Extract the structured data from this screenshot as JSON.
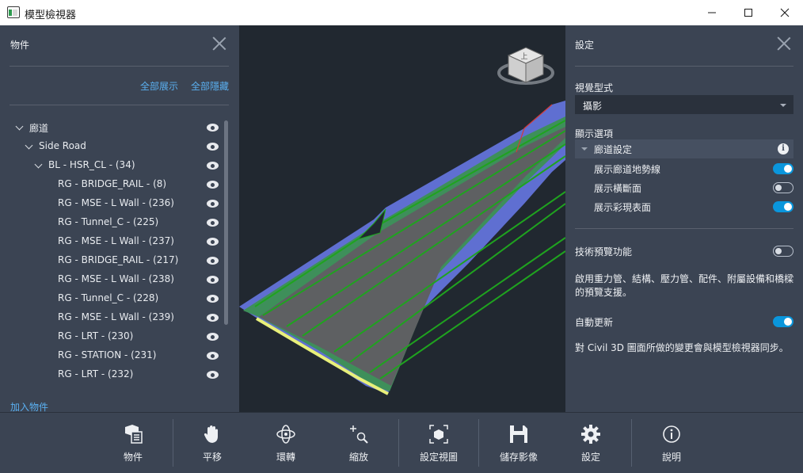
{
  "window": {
    "title": "模型檢視器",
    "minimize": "—",
    "maximize": "☐",
    "close": "✕"
  },
  "left_panel": {
    "title": "物件",
    "show_all": "全部展示",
    "hide_all": "全部隱藏",
    "add_object": "加入物件",
    "tree": [
      {
        "label": "廊道",
        "level": 0,
        "expandable": true,
        "visible": true
      },
      {
        "label": "Side Road",
        "level": 1,
        "expandable": true,
        "visible": true
      },
      {
        "label": "BL - HSR_CL - (34)",
        "level": 2,
        "expandable": true,
        "visible": true
      },
      {
        "label": "RG - BRIDGE_RAIL - (8)",
        "level": 3,
        "expandable": false,
        "visible": true
      },
      {
        "label": "RG - MSE - L Wall - (236)",
        "level": 3,
        "expandable": false,
        "visible": true
      },
      {
        "label": "RG - Tunnel_C - (225)",
        "level": 3,
        "expandable": false,
        "visible": true
      },
      {
        "label": "RG - MSE - L Wall - (237)",
        "level": 3,
        "expandable": false,
        "visible": true
      },
      {
        "label": "RG - BRIDGE_RAIL - (217)",
        "level": 3,
        "expandable": false,
        "visible": true
      },
      {
        "label": "RG - MSE - L Wall - (238)",
        "level": 3,
        "expandable": false,
        "visible": true
      },
      {
        "label": "RG - Tunnel_C - (228)",
        "level": 3,
        "expandable": false,
        "visible": true
      },
      {
        "label": "RG - MSE - L Wall - (239)",
        "level": 3,
        "expandable": false,
        "visible": true
      },
      {
        "label": "RG - LRT - (230)",
        "level": 3,
        "expandable": false,
        "visible": true
      },
      {
        "label": "RG - STATION - (231)",
        "level": 3,
        "expandable": false,
        "visible": true
      },
      {
        "label": "RG - LRT - (232)",
        "level": 3,
        "expandable": false,
        "visible": true
      }
    ]
  },
  "viewcube": {
    "face_label": "上"
  },
  "right_panel": {
    "title": "設定",
    "visual_style_label": "視覺型式",
    "visual_style_value": "攝影",
    "display_options_label": "顯示選項",
    "corridor_settings_label": "廊道設定",
    "options": [
      {
        "label": "展示廊道地勢線",
        "enabled": true
      },
      {
        "label": "展示橫斷面",
        "enabled": false
      },
      {
        "label": "展示彩現表面",
        "enabled": true
      }
    ],
    "tech_preview_label": "技術預覽功能",
    "tech_preview_enabled": false,
    "tech_preview_desc": "啟用重力管、結構、壓力管、配件、附屬設備和橋樑的預覽支援。",
    "auto_update_label": "自動更新",
    "auto_update_enabled": true,
    "auto_update_desc": "對 Civil 3D 圖面所做的變更會與模型檢視器同步。"
  },
  "toolbar": {
    "objects": "物件",
    "pan": "平移",
    "orbit": "環轉",
    "zoom": "縮放",
    "set_view": "設定視圖",
    "save_image": "儲存影像",
    "settings": "設定",
    "help": "說明"
  },
  "colors": {
    "panel_bg": "#3b4453",
    "viewport_bg": "#212830",
    "accent_link": "#5aaff0",
    "toggle_on": "#0a96dc"
  }
}
